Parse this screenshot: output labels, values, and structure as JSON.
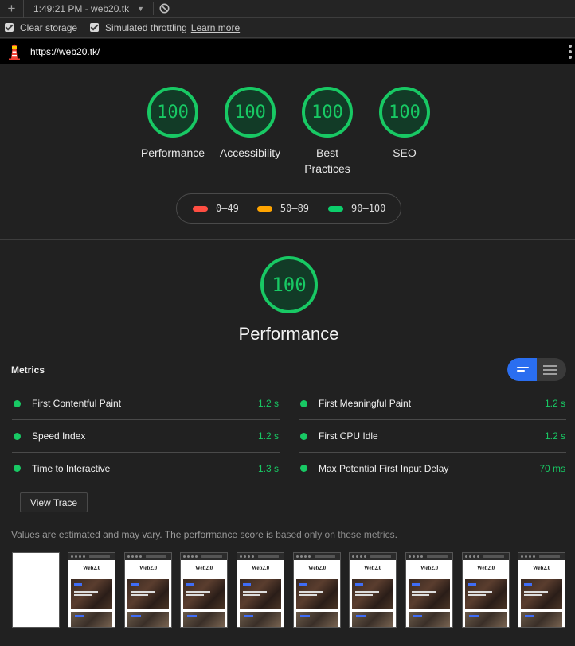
{
  "toolbar": {
    "report_time": "1:49:21 PM - web20.tk"
  },
  "options": {
    "clear_storage": "Clear storage",
    "simulated_throttling": "Simulated throttling",
    "learn_more": "Learn more"
  },
  "lighthouse": {
    "url": "https://web20.tk/"
  },
  "summary": [
    {
      "score": "100",
      "label": "Performance"
    },
    {
      "score": "100",
      "label": "Accessibility"
    },
    {
      "score": "100",
      "label": "Best Practices"
    },
    {
      "score": "100",
      "label": "SEO"
    }
  ],
  "legend": [
    {
      "range": "0–49",
      "color": "#ff4e42"
    },
    {
      "range": "50–89",
      "color": "#ffa400"
    },
    {
      "range": "90–100",
      "color": "#0cce6b"
    }
  ],
  "performance": {
    "score": "100",
    "title": "Performance",
    "metrics_heading": "Metrics",
    "metrics_left": [
      {
        "name": "First Contentful Paint",
        "value": "1.2 s"
      },
      {
        "name": "Speed Index",
        "value": "1.2 s"
      },
      {
        "name": "Time to Interactive",
        "value": "1.3 s"
      }
    ],
    "metrics_right": [
      {
        "name": "First Meaningful Paint",
        "value": "1.2 s"
      },
      {
        "name": "First CPU Idle",
        "value": "1.2 s"
      },
      {
        "name": "Max Potential First Input Delay",
        "value": "70 ms"
      }
    ],
    "view_trace": "View Trace",
    "note_text": "Values are estimated and may vary. The performance score is ",
    "note_link": "based only on these metrics",
    "note_end": ".",
    "filmstrip_brand": "Web2.0"
  },
  "colors": {
    "pass": "#18c964",
    "toggle_active": "#2a6ef0"
  }
}
